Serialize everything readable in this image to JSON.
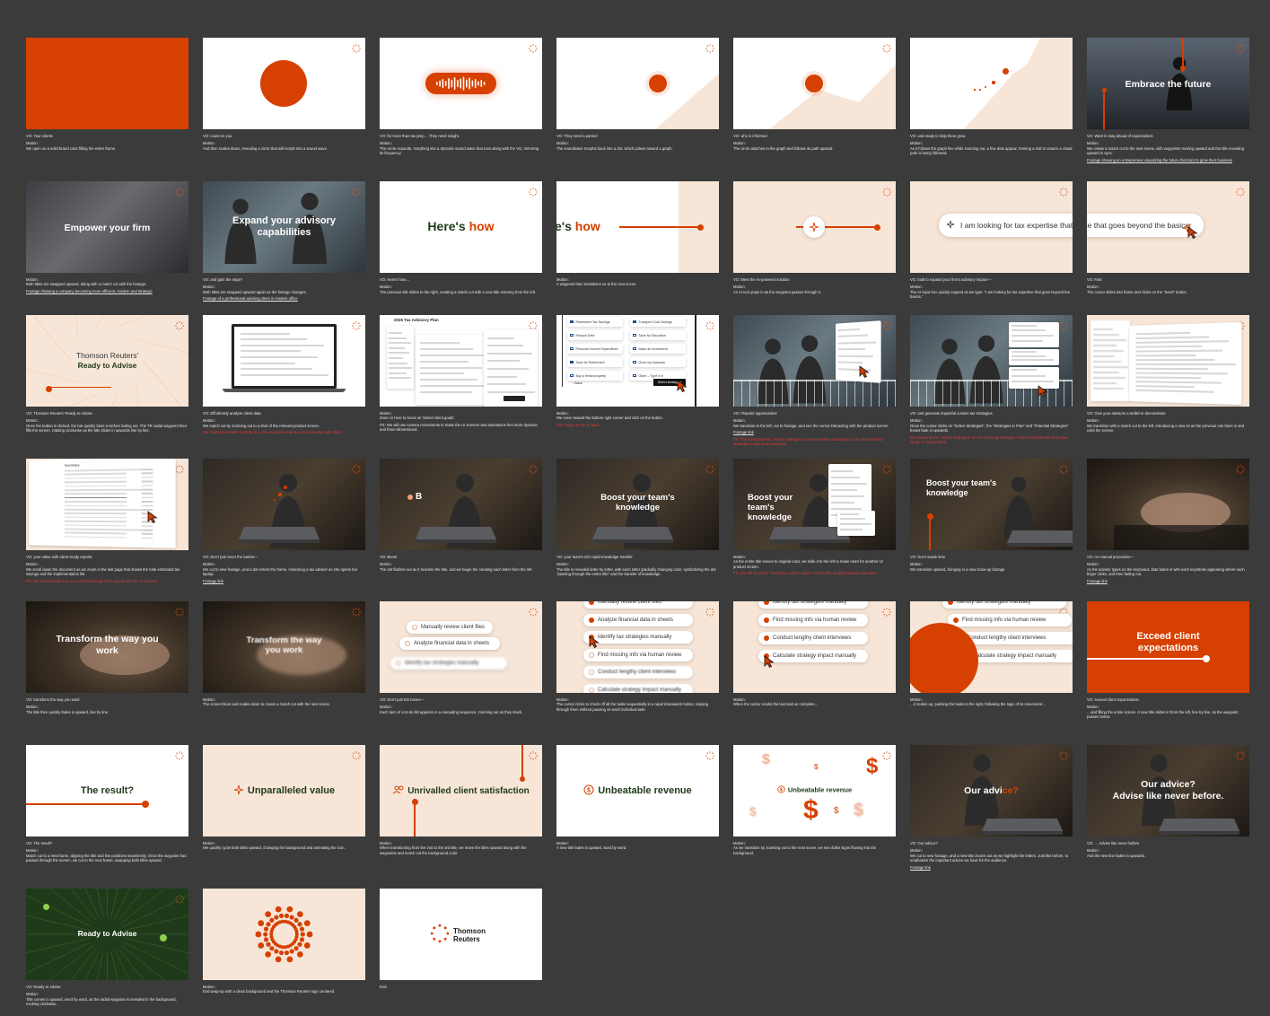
{
  "colors": {
    "canvas": "#3b3b3b",
    "accent": "#d64000",
    "cream": "#f7e6d8",
    "green": "#1f3a19"
  },
  "brand": {
    "line1": "Thomson",
    "line2": "Reuters"
  },
  "frames": [
    {
      "vo": "VO: Your clients",
      "motion": "Motion:",
      "desc": "We open on a solid brand color filling the entire frame."
    },
    {
      "vo": "VO: count on you",
      "motion": "Motion:",
      "desc": "And then scales down, revealing a circle that will morph into a sound wave."
    },
    {
      "vo": "VO: for more than tax prep… They need insight.",
      "motion": "Motion:",
      "desc": "The circle expands, morphing into a dynamic sound wave that runs along with the VO, mirroring its frequency."
    },
    {
      "vo": "VO: They need a partner",
      "motion": "Motion:",
      "desc": "The soundwave morphs back into a dot, which pulses toward a graph."
    },
    {
      "vo": "VO: who is informed",
      "motion": "Motion:",
      "desc": "The circle attaches to the graph and follows its path upward."
    },
    {
      "vo": "VO: and ready to help them grow.",
      "motion": "Motion:",
      "desc": "As it follows the graph line while zooming out, a few dots appear, forming a trail to ensure a visual path is being followed."
    },
    {
      "vo": "VO: Want to stay ahead of expectations",
      "motion": "Motion:",
      "desc": "We create a match cut to the next scene, with waypoints moving upward and the title revealing upward in sync.",
      "title": "Embrace the future",
      "link": "Footage showing an entrepreneur visualizing the future (horizon) to grow their business"
    },
    {
      "vo": "",
      "motion": "Motion:",
      "desc": "Both titles are swapped upward, along with a match cut with the footage.",
      "title": "Empower your firm",
      "link": "Footage showing a company becoming more efficient, modern and strategic"
    },
    {
      "vo": "VO: and gain the edge?",
      "motion": "Motion:",
      "desc": "Both titles are swapped upward again as the footage changes.",
      "title": "Expand your advisory capabilities",
      "link": "Footage of a professional advising client in modern office"
    },
    {
      "vo": "VO: Here's how…",
      "motion": "Motion:",
      "desc": "The previous title slides to the right, creating a match cut with a new title entering from the left.",
      "title_a": "Here's",
      "title_b": "how"
    },
    {
      "vo": "",
      "motion": "Motion:",
      "desc": "A waypoint then transitions us to the next scene.",
      "title_a": "e's",
      "title_b": "how"
    },
    {
      "vo": "VO: Meet the AI-powered solution",
      "motion": "Motion:",
      "desc": "An AI icon pops in as the waypoint passes through it."
    },
    {
      "vo": "VO: built to expand your firm's advisory impact—",
      "motion": "Motion:",
      "desc": "The AI input box quickly expand as we type: \"I am looking for tax expertise that goes beyond the basics.\"",
      "input": "I am looking for tax expertise that goes beyond the basics."
    },
    {
      "vo": "VO: Fast",
      "motion": "Motion:",
      "desc": "The cursor slides into frame and clicks on the \"Send\" button."
    },
    {
      "vo": "VO: Thomson Reuters' Ready to Advise.",
      "motion": "Motion:",
      "desc": "Once the button is clicked, the bar quickly blurs in before fading out. The TR radial waypoint then fills the screen, rotating clockwise as the title slides in upwards line by line.",
      "title_a": "Thomson Reuters'",
      "title_b": "Ready to Advise"
    },
    {
      "vo": "VO: Effortlessly analyze client data",
      "motion": "Motion:",
      "desc": "We match cut by zooming out to a shot of the relevant product screen.",
      "warn": "We should remember to show in a non-AI-powered area to avoid overlap with client."
    },
    {
      "vo": "",
      "motion": "Motion:",
      "desc": "Zoom in here to focus on 'Select client goals'.",
      "warn2": "PS: We will use camera movements to make the UI screens and animations feel more dynamic and three-dimensional.",
      "screen_title": "2025 Tax Advisory Plan"
    },
    {
      "vo": "",
      "motion": "Motion:",
      "desc": "We move toward the bottom right corner and click on the button.",
      "warn": "Use image as the product",
      "opts": [
        "Retirement Tax Savings",
        "Reduce Debt",
        "Personal Income Expenditure",
        "Save for Retirement",
        "Buy a rental property",
        "Transport Cost Savings",
        "Save for Education",
        "Make an Investment",
        "Grow my business",
        "Other – Type it in"
      ],
      "btn": "Select strategies",
      "back": "Back"
    },
    {
      "vo": "VO: Pinpoint opportunities",
      "motion": "Motion:",
      "desc": "We transition to the left, cut to footage, and see the cursor interacting with the product screen",
      "link": "Footage link",
      "warn": "PS: The transitions the \"Select Strategies\" screen showing strategies in tone and potential strategies image is incorporated."
    },
    {
      "vo": "VO: and generate impactful custom tax strategies",
      "motion": "Motion:",
      "desc": "Once the cursor clicks on \"Select Strategies\", the \"Strategies in Plan\" and \"Potential Strategies\" boxes fade in upwards.",
      "warn": "We should fix the \"Select Strategies\" screen showing strategies in plan and potential strategies image is incorporated."
    },
    {
      "vo": "VO: Give your advisors a toolkit to demonstrate",
      "motion": "Motion:",
      "desc": "We transition with a match cut to the left, introducing a new UI as the previous one blurs in and exits the screen."
    },
    {
      "vo": "VO: your value with client-ready reports.",
      "motion": "Motion:",
      "desc": "We scroll down the document as we zoom in the last page that shows the total estimated tax savings and the implementation list.",
      "warn": "PS: We should make sure to avoid the footage to be mixed with the UI screens."
    },
    {
      "vo": "VO: Don't just cover the basics—",
      "motion": "Motion:",
      "desc": "We cut to new footage, and a dot enters the frame, mimicking a tax advisor as she opens her laptop.",
      "link": "Footage link"
    },
    {
      "vo": "VO: Boost",
      "motion": "Motion:",
      "desc": "The dot flashes out as it reaches the title, and we begin the creating each letter from the left.",
      "title": "B"
    },
    {
      "vo": "VO: your team's rich rapid knowledge transfer.",
      "motion": "Motion:",
      "desc": "The title is revealed letter by letter, with each letter gradually changing color, symbolizing the dot \"passing through the entire title\" and the transfer of knowledge.",
      "title": "Boost your team's knowledge"
    },
    {
      "vo": "",
      "motion": "Motion:",
      "desc": "As the entire title moves to original color, we slide it to the left to make room for another UI product screen.",
      "warn": "PS: We will show the \"Generate custom report\" screen with loading indicator animation.",
      "title": "Boost your team's knowledge"
    },
    {
      "vo": "VO: Don't waste time",
      "motion": "Motion:",
      "desc": "We transition upward, bringing in a new close-up footage.",
      "title": "Boost your team's knowledge"
    },
    {
      "vo": "VO: on manual processes—",
      "motion": "Motion:",
      "desc": "As the advisor types on the keyboard, data fades in with each keystroke appearing where each finger clicks, and then fading out.",
      "link": "Footage link"
    },
    {
      "vo": "VO: transform the way you work.",
      "motion": "Motion:",
      "desc": "The title then quickly fades in upward, line by line.",
      "title": "Transform the way you work"
    },
    {
      "vo": "",
      "motion": "Motion:",
      "desc": "The screen blurs and scales down to create a match cut with the next scene.",
      "title": "Transform the way you work"
    },
    {
      "vo": "VO: Don't just tick boxes—",
      "motion": "Motion:",
      "desc": "Each item of a to-do list appears in a cascading sequence, zooming out as they stack.",
      "tasks": [
        "Manually review client files",
        "Analyze financial data in sheets",
        "Identify tax strategies manually"
      ]
    },
    {
      "vo": "",
      "motion": "Motion:",
      "desc": "The cursor clicks to check off all the tasks sequentially in a rapid downward motion, swiping through them without pausing on each individual task.",
      "tasks": [
        "Manually review client files",
        "Analyze financial data in sheets",
        "Identify tax strategies manually",
        "Find missing info via human review",
        "Conduct lengthy client interviews",
        "Calculate strategy impact manually"
      ]
    },
    {
      "vo": "",
      "motion": "Motion:",
      "desc": "When the cursor marks the last task as complete…",
      "tasks": [
        "Identify tax strategies manually",
        "Find missing info via human review",
        "Conduct lengthy client interviews",
        "Calculate strategy impact manually"
      ]
    },
    {
      "vo": "",
      "motion": "Motion:",
      "desc": "…it scales up, pushing the tasks to the right, following the logic of its movement…",
      "tasks": [
        "Identify tax strategies manually",
        "Find missing info via human review",
        "Conduct lengthy client interviews",
        "Calculate strategy impact manually"
      ]
    },
    {
      "vo": "VO: exceed client expectations.",
      "motion": "Motion:",
      "desc": "…and filling the entire screen. A new title slides in from the left, line by line, as the waypoint passes below.",
      "title": "Exceed client expectations"
    },
    {
      "vo": "VO: The result?",
      "motion": "Motion:",
      "desc": "Match cut to a new frame, aligning the title and line positions seamlessly. Once the waypoint has passed through the screen, we cut to the next frame, swapping both titles upward.",
      "title": "The result?"
    },
    {
      "vo": "",
      "motion": "Motion:",
      "desc": "We quickly cycle both titles upward, changing the background and animating the icon.",
      "title": "Unparalleled value"
    },
    {
      "vo": "",
      "motion": "Motion:",
      "desc": "When transitioning from the 2nd to the 3rd title, we move the titles upward along with the waypoints and match cut the background color.",
      "title": "Unrivalled client satisfaction"
    },
    {
      "vo": "",
      "motion": "Motion:",
      "desc": "A new title fades in upward, word by word.",
      "title": "Unbeatable revenue"
    },
    {
      "vo": "",
      "motion": "Motion:",
      "desc": "As we transition by zooming out to the next scene, we see dollar signs flowing into the background.",
      "title": "Unbeatable revenue"
    },
    {
      "vo": "VO: Our advice?",
      "motion": "Motion:",
      "desc": "We cut to new footage, and a new title zooms out as we highlight the letters. Just like before, to emphasize the important advice we have for the audience.",
      "link": "Footage link",
      "title_a": "Our advi",
      "title_b": "ce?"
    },
    {
      "vo": "VO: … Advise like never before.",
      "motion": "Motion:",
      "desc": "And the new line fades in upwards.",
      "title_a": "Our advice?",
      "title_b": "Advise like never before."
    },
    {
      "vo": "VO: Ready to Advise",
      "motion": "Motion:",
      "desc": "Title comes in upward, word by word, as the radial waypoint is revealed in the background, evoking clockwise.",
      "title": "Ready to Advise"
    },
    {
      "vo": "",
      "motion": "Motion:",
      "desc": "End wrap-up with a clean background and the Thomson Reuters logo centered."
    },
    {
      "vo": "",
      "motion": "End.",
      "desc": "",
      "logo_a": "Thomson",
      "logo_b": "Reuters"
    }
  ]
}
